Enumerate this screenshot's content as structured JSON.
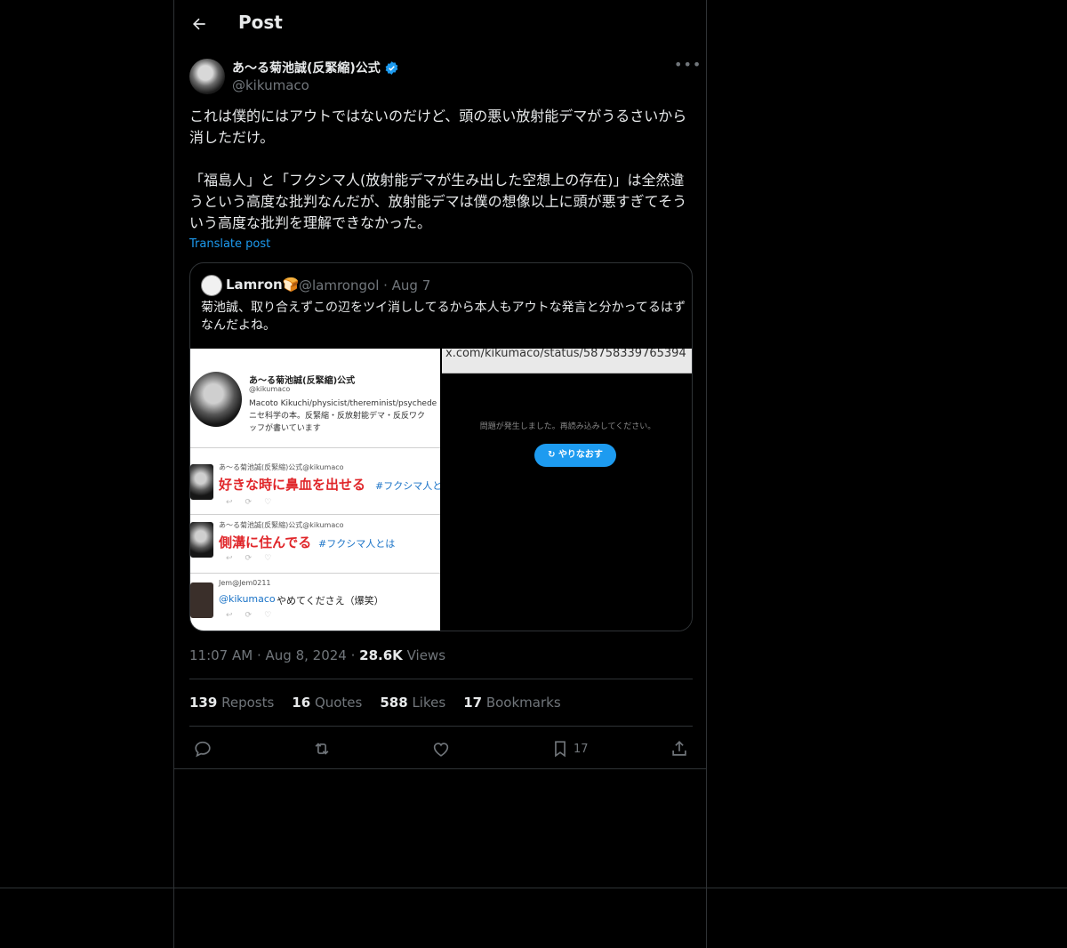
{
  "header": {
    "title": "Post"
  },
  "author": {
    "display_name": "あ〜る菊池誠(反緊縮)公式",
    "handle": "@kikumaco"
  },
  "post": {
    "text": "これは僕的にはアウトではないのだけど、頭の悪い放射能デマがうるさいから消しただけ。\n\n「福島人」と「フクシマ人(放射能デマが生み出した空想上の存在)」は全然違うという高度な批判なんだが、放射能デマは僕の想像以上に頭が悪すぎてそういう高度な批判を理解できなかった。",
    "translate_label": "Translate post"
  },
  "quote": {
    "name": "Lamron🍞",
    "handle": "@lamrongol · Aug 7",
    "text": "菊池誠、取り合えずこの辺をツイ消ししてるから本人もアウトな発言と分かってるはずなんだよね。",
    "image_left": {
      "profile_name": "あ〜る菊池誠(反緊縮)公式",
      "profile_handle": "@kikumaco",
      "profile_bio_1": "Macoto Kikuchi/physicist/thereminist/psychede",
      "profile_bio_2": "ニセ科学の本。反緊縮・反放射能デマ・反反ワク",
      "profile_bio_3": "ッフが書いています",
      "tweet1_meta": "あ〜る菊池誠(反緊縮)公式@kikumaco",
      "tweet1_red": "好きな時に鼻血を出せる",
      "tweet1_tag": "#フクシマ人と",
      "tweet2_meta": "あ〜る菊池誠(反緊縮)公式@kikumaco",
      "tweet2_red": "側溝に住んでる",
      "tweet2_tag": "#フクシマ人とは",
      "tweet3_meta": "Jem@Jem0211",
      "tweet3_mention": "@kikumaco",
      "tweet3_text": "やめてくださえ（爆笑）"
    },
    "image_right": {
      "url_text": "x.com/kikumaco/status/58758339765394",
      "error_text": "問題が発生しました。再読み込みしてください。",
      "retry_label": "やりなおす"
    }
  },
  "meta": {
    "time": "11:07 AM",
    "date": "Aug 8, 2024",
    "views_count": "28.6K",
    "views_label": "Views"
  },
  "stats": {
    "reposts_count": "139",
    "reposts_label": "Reposts",
    "quotes_count": "16",
    "quotes_label": "Quotes",
    "likes_count": "588",
    "likes_label": "Likes",
    "bookmarks_count": "17",
    "bookmarks_label": "Bookmarks"
  },
  "actions": {
    "bookmark_count": "17"
  },
  "colors": {
    "background": "#000000",
    "accent": "#1d9bf0",
    "muted": "#71767b",
    "border": "#2f3336"
  },
  "icons": [
    "back-arrow-icon",
    "verified-badge-icon",
    "more-icon",
    "reply-icon",
    "repost-icon",
    "like-icon",
    "bookmark-icon",
    "share-icon",
    "refresh-icon"
  ]
}
